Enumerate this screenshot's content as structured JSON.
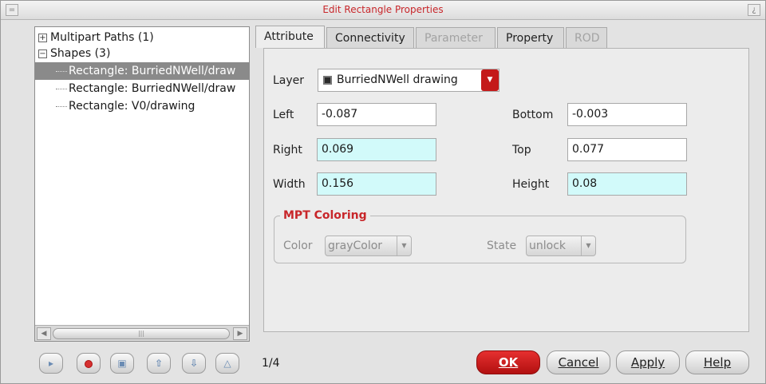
{
  "window": {
    "title": "Edit Rectangle Properties",
    "left_button": "=",
    "right_button": "¿"
  },
  "tree": {
    "items": [
      {
        "label": "Multipart Paths (1)",
        "expander": "+"
      },
      {
        "label": "Shapes (3)",
        "expander": "−"
      },
      {
        "label": "Rectangle: BurriedNWell/draw",
        "selected": true
      },
      {
        "label": "Rectangle: BurriedNWell/draw"
      },
      {
        "label": "Rectangle: V0/drawing"
      }
    ],
    "scroll_left": "◀",
    "scroll_right": "▶",
    "scroll_grip": "|||"
  },
  "toolbar": {
    "buttons": [
      {
        "name": "play-icon",
        "glyph": "▸"
      },
      {
        "name": "stop-icon",
        "glyph": ""
      },
      {
        "name": "save-icon",
        "glyph": "▣"
      },
      {
        "name": "up-arrow-icon",
        "glyph": "⇧"
      },
      {
        "name": "down-arrow-icon",
        "glyph": "⇩"
      },
      {
        "name": "warning-icon",
        "glyph": "△"
      }
    ],
    "counter": "1/4"
  },
  "tabs": [
    {
      "label": "Attribute",
      "active": true
    },
    {
      "label": "Connectivity"
    },
    {
      "label": "Parameter",
      "disabled": true
    },
    {
      "label": "Property"
    },
    {
      "label": "ROD",
      "disabled": true
    }
  ],
  "attribute": {
    "layer_label": "Layer",
    "layer_value": "BurriedNWell drawing",
    "layer_dropdown_glyph": "▼",
    "left_label": "Left",
    "left_value": "-0.087",
    "bottom_label": "Bottom",
    "bottom_value": "-0.003",
    "right_label": "Right",
    "right_value": "0.069",
    "top_label": "Top",
    "top_value": "0.077",
    "width_label": "Width",
    "width_value": "0.156",
    "height_label": "Height",
    "height_value": "0.08",
    "highlight_color": "#d2fafa"
  },
  "mpt": {
    "title": "MPT Coloring",
    "color_label": "Color",
    "color_value": "grayColor",
    "state_label": "State",
    "state_value": "unlock",
    "dropdown_glyph": "▼"
  },
  "buttons": {
    "ok": "OK",
    "cancel": "Cancel",
    "apply": "Apply",
    "help": "Help"
  },
  "colors": {
    "title_red": "#c8262a",
    "ok_red": "#c41a1a",
    "selection_gray": "#8a8a8a"
  }
}
